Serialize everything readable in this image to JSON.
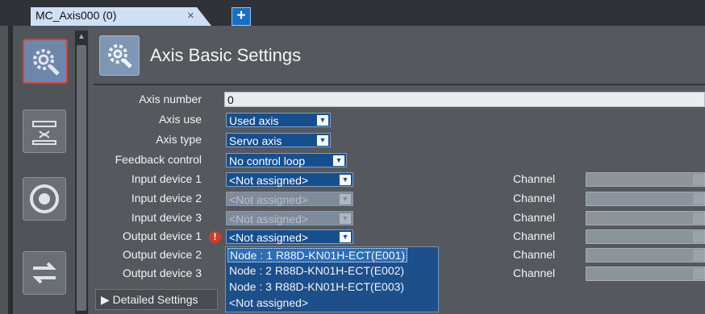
{
  "tabs": [
    {
      "label": "MC_Axis000 (0)",
      "close": "×"
    }
  ],
  "tab_add": "+",
  "header": {
    "title": "Axis Basic Settings"
  },
  "scroll_up": "▲",
  "fields": {
    "axis_number": {
      "label": "Axis number",
      "value": "0"
    },
    "axis_use": {
      "label": "Axis use",
      "value": "Used axis"
    },
    "axis_type": {
      "label": "Axis type",
      "value": "Servo axis"
    },
    "feedback_control": {
      "label": "Feedback control",
      "value": "No control loop"
    },
    "input_device_1": {
      "label": "Input device 1",
      "value": "<Not assigned>"
    },
    "input_device_2": {
      "label": "Input device 2",
      "value": "<Not assigned>"
    },
    "input_device_3": {
      "label": "Input device 3",
      "value": "<Not assigned>"
    },
    "output_device_1": {
      "label": "Output device 1",
      "value": "<Not assigned>"
    },
    "output_device_2": {
      "label": "Output device 2"
    },
    "output_device_3": {
      "label": "Output device 3"
    }
  },
  "channel_label": "Channel",
  "arrow": "▼",
  "warning_mark": "!",
  "dropdown_options": [
    "Node : 1 R88D-KN01H-ECT(E001)",
    "Node : 2 R88D-KN01H-ECT(E002)",
    "Node : 3 R88D-KN01H-ECT(E003)",
    "<Not assigned>"
  ],
  "detailed_settings": "▶ Detailed Settings",
  "colors": {
    "accent": "#164f8e",
    "warning": "#d23b2a",
    "tab": "#cfe0f5"
  },
  "icons": [
    "gear-search-icon",
    "ruler-icon",
    "dial-icon",
    "swap-arrows-icon"
  ]
}
